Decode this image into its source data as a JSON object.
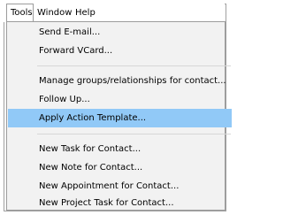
{
  "menubar": {
    "items": [
      {
        "label": "Tools"
      },
      {
        "label": "Window"
      },
      {
        "label": "Help"
      }
    ]
  },
  "tools_menu": {
    "groups": [
      [
        "Send E-mail...",
        "Forward VCard..."
      ],
      [
        "Manage groups/relationships for contact...",
        "Follow Up...",
        "Apply Action Template..."
      ],
      [
        "New Task for Contact...",
        "New Note for Contact...",
        "New Appointment for Contact...",
        "New Project Task for Contact..."
      ]
    ],
    "highlighted_item": "Apply Action Template...",
    "highlight_color": "#91c9f7"
  }
}
